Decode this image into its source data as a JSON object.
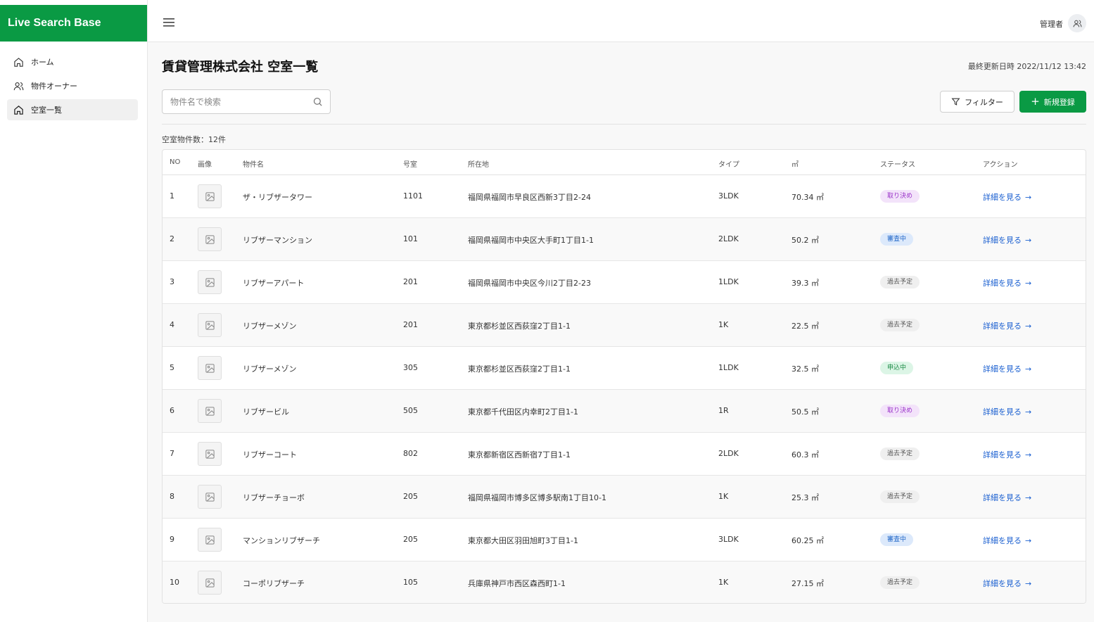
{
  "app": {
    "brand": "Live Search Base"
  },
  "sidebar": {
    "items": [
      {
        "label": "ホーム",
        "icon": "home-icon",
        "active": false
      },
      {
        "label": "物件オーナー",
        "icon": "users-icon",
        "active": false
      },
      {
        "label": "空室一覧",
        "icon": "home-icon",
        "active": true
      }
    ]
  },
  "header": {
    "user_name": "管理者"
  },
  "page": {
    "title": "賃貸管理株式会社 空室一覧",
    "updated": "最終更新日時 2022/11/12 13:42"
  },
  "search": {
    "placeholder": "物件名で検索",
    "value": ""
  },
  "toolbar": {
    "filter_label": "フィルター",
    "new_label": "新規登録"
  },
  "summary": {
    "count_text": "空室物件数：12件"
  },
  "table": {
    "headers": {
      "no": "NO",
      "image": "画像",
      "name": "物件名",
      "room": "号室",
      "address": "所在地",
      "type": "タイプ",
      "area": "㎡",
      "status": "ステータス",
      "action": "アクション"
    },
    "action_label": "詳細を見る",
    "rows": [
      {
        "no": "1",
        "name": "ザ・リブザータワー",
        "room": "1101",
        "address": "福岡県福岡市早良区西新3丁目2-24",
        "type": "3LDK",
        "area": "70.34 ㎡",
        "status": "取り決め"
      },
      {
        "no": "2",
        "name": "リブザーマンション",
        "room": "101",
        "address": "福岡県福岡市中央区大手町1丁目1-1",
        "type": "2LDK",
        "area": "50.2 ㎡",
        "status": "審査中"
      },
      {
        "no": "3",
        "name": "リブザーアパート",
        "room": "201",
        "address": "福岡県福岡市中央区今川2丁目2-23",
        "type": "1LDK",
        "area": "39.3 ㎡",
        "status": "過去予定"
      },
      {
        "no": "4",
        "name": "リブザーメゾン",
        "room": "201",
        "address": "東京都杉並区西荻窪2丁目1-1",
        "type": "1K",
        "area": "22.5 ㎡",
        "status": "過去予定"
      },
      {
        "no": "5",
        "name": "リブザーメゾン",
        "room": "305",
        "address": "東京都杉並区西荻窪2丁目1-1",
        "type": "1LDK",
        "area": "32.5 ㎡",
        "status": "申込中"
      },
      {
        "no": "6",
        "name": "リブザービル",
        "room": "505",
        "address": "東京都千代田区内幸町2丁目1-1",
        "type": "1R",
        "area": "50.5 ㎡",
        "status": "取り決め"
      },
      {
        "no": "7",
        "name": "リブザーコート",
        "room": "802",
        "address": "東京都新宿区西新宿7丁目1-1",
        "type": "2LDK",
        "area": "60.3 ㎡",
        "status": "過去予定"
      },
      {
        "no": "8",
        "name": "リブザーチョーボ",
        "room": "205",
        "address": "福岡県福岡市博多区博多駅南1丁目10-1",
        "type": "1K",
        "area": "25.3 ㎡",
        "status": "過去予定"
      },
      {
        "no": "9",
        "name": "マンションリブザーチ",
        "room": "205",
        "address": "東京都大田区羽田旭町3丁目1-1",
        "type": "3LDK",
        "area": "60.25 ㎡",
        "status": "審査中"
      },
      {
        "no": "10",
        "name": "コーポリブザーチ",
        "room": "105",
        "address": "兵庫県神戸市西区森西町1-1",
        "type": "1K",
        "area": "27.15 ㎡",
        "status": "過去予定"
      }
    ]
  },
  "status_colors": {
    "取り決め": {
      "bg": "#f3e3fa",
      "fg": "#9b35c9"
    },
    "審査中": {
      "bg": "#dce9fb",
      "fg": "#2066c8"
    },
    "過去予定": {
      "bg": "#efefef",
      "fg": "#555555"
    },
    "申込中": {
      "bg": "#dcf5e6",
      "fg": "#1b8a45"
    }
  },
  "colors": {
    "brand": "#0a9a44",
    "link": "#1a5fd0"
  }
}
